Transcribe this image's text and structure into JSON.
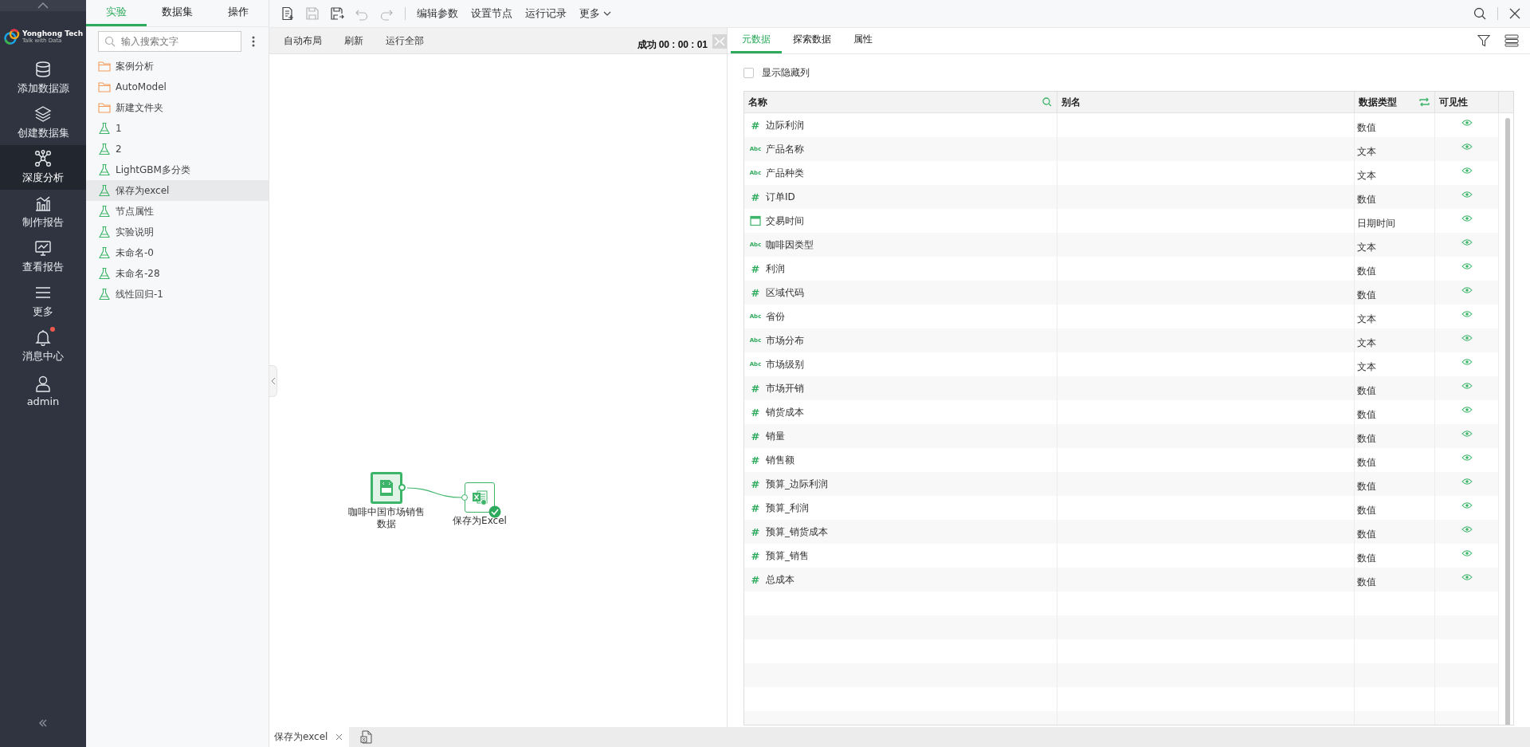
{
  "nav": {
    "logo": {
      "name": "Yonghong Tech",
      "tagline": "Talk with Data"
    },
    "items": [
      {
        "kind": "database",
        "label": "添加数据源",
        "selected": false,
        "badge": false
      },
      {
        "kind": "layers",
        "label": "创建数据集",
        "selected": false,
        "badge": false
      },
      {
        "kind": "network",
        "label": "深度分析",
        "selected": true,
        "badge": false
      },
      {
        "kind": "chart",
        "label": "制作报告",
        "selected": false,
        "badge": false
      },
      {
        "kind": "monitor",
        "label": "查看报告",
        "selected": false,
        "badge": false
      },
      {
        "kind": "menu",
        "label": "更多",
        "selected": false,
        "badge": false
      },
      {
        "kind": "bell",
        "label": "消息中心",
        "selected": false,
        "badge": true
      },
      {
        "kind": "user",
        "label": "admin",
        "selected": false,
        "badge": false
      }
    ]
  },
  "tree_panel": {
    "tabs": [
      {
        "label": "实验",
        "selected": true
      },
      {
        "label": "数据集",
        "selected": false
      },
      {
        "label": "操作",
        "selected": false
      }
    ],
    "search": {
      "placeholder": "输入搜索文字"
    },
    "items": [
      {
        "kind": "folder",
        "label": "案例分析",
        "selected": false
      },
      {
        "kind": "folder",
        "label": "AutoModel",
        "selected": false
      },
      {
        "kind": "folder",
        "label": "新建文件夹",
        "selected": false
      },
      {
        "kind": "experiment",
        "label": "1",
        "selected": false
      },
      {
        "kind": "experiment",
        "label": "2",
        "selected": false
      },
      {
        "kind": "experiment",
        "label": "LightGBM多分类",
        "selected": false
      },
      {
        "kind": "experiment",
        "label": "保存为excel",
        "selected": true
      },
      {
        "kind": "experiment",
        "label": "节点属性",
        "selected": false
      },
      {
        "kind": "experiment",
        "label": "实验说明",
        "selected": false
      },
      {
        "kind": "experiment",
        "label": "未命名-0",
        "selected": false
      },
      {
        "kind": "experiment",
        "label": "未命名-28",
        "selected": false
      },
      {
        "kind": "experiment",
        "label": "线性回归-1",
        "selected": false
      }
    ]
  },
  "toolbar": {
    "icons": [
      {
        "kind": "new",
        "disabled": false
      },
      {
        "kind": "save",
        "disabled": true
      },
      {
        "kind": "save-as",
        "disabled": false
      },
      {
        "kind": "undo",
        "disabled": true
      },
      {
        "kind": "redo",
        "disabled": true
      }
    ],
    "actions": [
      "编辑参数",
      "设置节点",
      "运行记录"
    ],
    "more": "更多"
  },
  "canvas_bar": {
    "buttons": [
      "自动布局",
      "刷新",
      "运行全部"
    ],
    "status": "成功",
    "time": "00 : 00 : 01"
  },
  "canvas": {
    "nodes": [
      {
        "kind": "sql",
        "label": "咖啡中国市场销售数据",
        "done": false
      },
      {
        "kind": "excel",
        "label": "保存为Excel",
        "done": true
      }
    ]
  },
  "doc_tabs": [
    {
      "label": "保存为excel",
      "selected": true
    }
  ],
  "right_panel": {
    "tabs": [
      {
        "label": "元数据",
        "selected": true
      },
      {
        "label": "探索数据",
        "selected": false
      },
      {
        "label": "属性",
        "selected": false
      }
    ],
    "show_hidden": {
      "label": "显示隐藏列",
      "checked": false
    },
    "columns": [
      "名称",
      "别名",
      "数据类型",
      "可见性"
    ],
    "rows": [
      {
        "kind": "number",
        "type_mark": "#",
        "name": "边际利润",
        "data_type": "数值",
        "visible": true
      },
      {
        "kind": "text",
        "type_mark": "Abc",
        "name": "产品名称",
        "data_type": "文本",
        "visible": true
      },
      {
        "kind": "text",
        "type_mark": "Abc",
        "name": "产品种类",
        "data_type": "文本",
        "visible": true
      },
      {
        "kind": "number",
        "type_mark": "#",
        "name": "订单ID",
        "data_type": "数值",
        "visible": true
      },
      {
        "kind": "date",
        "name": "交易时间",
        "data_type": "日期时间",
        "visible": true
      },
      {
        "kind": "text",
        "type_mark": "Abc",
        "name": "咖啡因类型",
        "data_type": "文本",
        "visible": true
      },
      {
        "kind": "number",
        "type_mark": "#",
        "name": "利润",
        "data_type": "数值",
        "visible": true
      },
      {
        "kind": "number",
        "type_mark": "#",
        "name": "区域代码",
        "data_type": "数值",
        "visible": true
      },
      {
        "kind": "text",
        "type_mark": "Abc",
        "name": "省份",
        "data_type": "文本",
        "visible": true
      },
      {
        "kind": "text",
        "type_mark": "Abc",
        "name": "市场分布",
        "data_type": "文本",
        "visible": true
      },
      {
        "kind": "text",
        "type_mark": "Abc",
        "name": "市场级别",
        "data_type": "文本",
        "visible": true
      },
      {
        "kind": "number",
        "type_mark": "#",
        "name": "市场开销",
        "data_type": "数值",
        "visible": true
      },
      {
        "kind": "number",
        "type_mark": "#",
        "name": "销货成本",
        "data_type": "数值",
        "visible": true
      },
      {
        "kind": "number",
        "type_mark": "#",
        "name": "销量",
        "data_type": "数值",
        "visible": true
      },
      {
        "kind": "number",
        "type_mark": "#",
        "name": "销售额",
        "data_type": "数值",
        "visible": true
      },
      {
        "kind": "number",
        "type_mark": "#",
        "name": "预算_边际利润",
        "data_type": "数值",
        "visible": true
      },
      {
        "kind": "number",
        "type_mark": "#",
        "name": "预算_利润",
        "data_type": "数值",
        "visible": true
      },
      {
        "kind": "number",
        "type_mark": "#",
        "name": "预算_销货成本",
        "data_type": "数值",
        "visible": true
      },
      {
        "kind": "number",
        "type_mark": "#",
        "name": "预算_销售",
        "data_type": "数值",
        "visible": true
      },
      {
        "kind": "number",
        "type_mark": "#",
        "name": "总成本",
        "data_type": "数值",
        "visible": true
      }
    ]
  }
}
